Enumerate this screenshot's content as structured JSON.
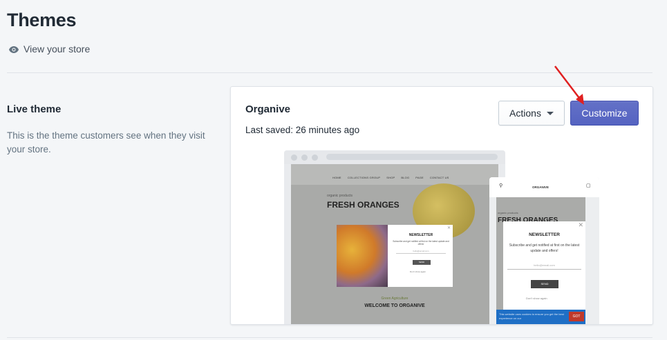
{
  "page": {
    "title": "Themes",
    "view_store_label": "View your store"
  },
  "live_theme": {
    "section_title": "Live theme",
    "section_description": "This is the theme customers see when they visit your store."
  },
  "theme_card": {
    "theme_name": "Organive",
    "last_saved": "Last saved: 26 minutes ago",
    "actions_label": "Actions",
    "customize_label": "Customize"
  },
  "preview": {
    "desktop": {
      "nav": [
        "HOME",
        "COLLECTIONS GROUP",
        "SHOP",
        "BLOG",
        "PAGE",
        "CONTACT US"
      ],
      "hero_sub": "organic products",
      "hero_title": "FRESH ORANGES",
      "newsletter_title": "NEWSLETTER",
      "newsletter_text": "Subscribe and get notified at first on the latest update and offers!",
      "email_placeholder": "hello@email.com",
      "send_label": "SEND",
      "dont_show": "Don't show again",
      "welcome_sub": "Green Agriculture",
      "welcome_title": "WELCOME TO ORGANIVE"
    },
    "mobile": {
      "logo_text": "ORGANIVE",
      "hero_sub": "organic products",
      "hero_title": "FRESH ORANGES",
      "newsletter_title": "NEWSLETTER",
      "newsletter_text": "Subscribe and get notified at first on the latest update and offers!",
      "email_placeholder": "hello@email.com",
      "send_label": "SEND",
      "dont_show": "Don't show again",
      "cookie_text": "This website uses cookies to ensure you get the best experience on our",
      "got_label": "GOT"
    }
  },
  "colors": {
    "primary_button": "#5c6ac4",
    "annotation_arrow": "#e02020",
    "background": "#f4f6f8"
  }
}
